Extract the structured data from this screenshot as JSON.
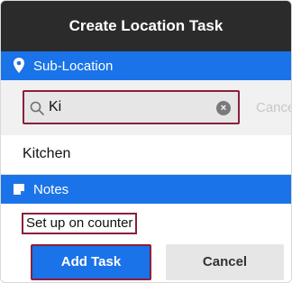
{
  "dialog": {
    "title": "Create Location Task"
  },
  "sub_location": {
    "header": "Sub-Location",
    "icon": "location-pin-icon",
    "search": {
      "value": "Ki",
      "cancel_label": "Cancel"
    },
    "results": [
      "Kitchen"
    ]
  },
  "notes": {
    "header": "Notes",
    "icon": "note-icon",
    "value": "Set up on counter"
  },
  "actions": {
    "add_label": "Add Task",
    "cancel_label": "Cancel"
  },
  "colors": {
    "titlebar": "#2b2b2b",
    "section": "#1a73e8",
    "highlight_border": "#8b1f3b"
  }
}
